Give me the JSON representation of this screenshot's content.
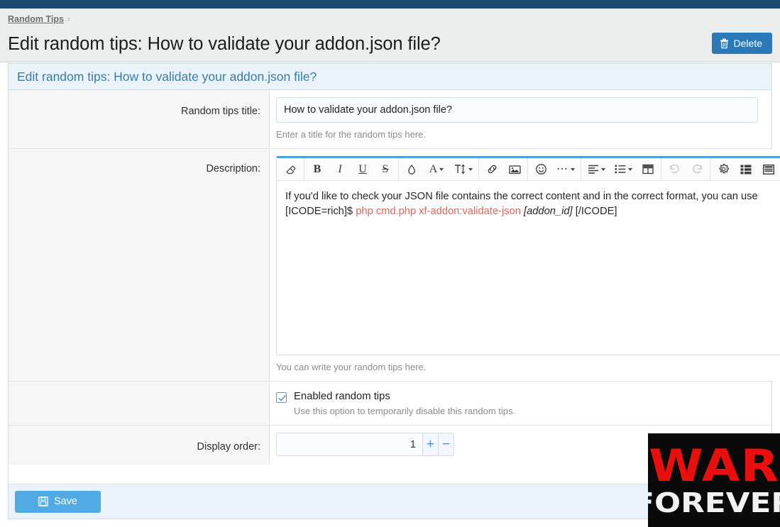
{
  "theme": {
    "topbar_color": "#1c4a70",
    "accent_blue": "#2a7ab9",
    "save_blue": "#52aae4",
    "header_band": "#eaf3fa",
    "code_red": "#e0655b"
  },
  "breadcrumb": {
    "root_label": "Random Tips",
    "separator": "›"
  },
  "header": {
    "page_title": "Edit random tips: How to validate your addon.json file?",
    "delete_label": "Delete",
    "delete_icon": "trash-icon"
  },
  "section": {
    "title": "Edit random tips: How to validate your addon.json file?"
  },
  "form": {
    "title_field": {
      "label": "Random tips title:",
      "value": "How to validate your addon.json file?",
      "placeholder": "",
      "hint": "Enter a title for the random tips here."
    },
    "description_field": {
      "label": "Description:",
      "hint": "You can write your random tips here.",
      "content": {
        "line1": "If you'd like to check your JSON file contains the correct content and in the correct format, you can use",
        "line2_open": "[ICODE=rich]$",
        "line2_code": "php cmd.php xf-addon:validate-json",
        "line2_param": "[addon_id]",
        "line2_close": "[/ICODE]"
      }
    },
    "enabled_field": {
      "label": "Enabled random tips",
      "checked": true,
      "hint": "Use this option to temporarily disable this random tips."
    },
    "display_order_field": {
      "label": "Display order:",
      "value": "1",
      "increment_label": "+",
      "decrement_label": "−"
    }
  },
  "editor_toolbar": {
    "groups": [
      {
        "buttons": [
          {
            "name": "remove-formatting-icon",
            "title": "Remove formatting",
            "glyph": "eraser"
          }
        ]
      },
      {
        "buttons": [
          {
            "name": "bold-icon",
            "title": "Bold",
            "glyph": "B"
          },
          {
            "name": "italic-icon",
            "title": "Italic",
            "glyph": "I"
          },
          {
            "name": "underline-icon",
            "title": "Underline",
            "glyph": "U"
          },
          {
            "name": "strikethrough-icon",
            "title": "Strike through",
            "glyph": "S"
          }
        ]
      },
      {
        "buttons": [
          {
            "name": "text-color-icon",
            "title": "Text color",
            "glyph": "drop"
          },
          {
            "name": "font-family-icon",
            "title": "Font",
            "glyph": "A",
            "has_caret": true
          },
          {
            "name": "font-size-icon",
            "title": "Font size",
            "glyph": "TI",
            "has_caret": true
          }
        ]
      },
      {
        "buttons": [
          {
            "name": "link-icon",
            "title": "Insert link",
            "glyph": "link"
          },
          {
            "name": "image-icon",
            "title": "Insert image",
            "glyph": "image"
          }
        ]
      },
      {
        "buttons": [
          {
            "name": "smilies-icon",
            "title": "Smilies",
            "glyph": "smile"
          },
          {
            "name": "more-options-icon",
            "title": "More options",
            "glyph": "dots",
            "has_caret": true
          }
        ]
      },
      {
        "buttons": [
          {
            "name": "text-align-icon",
            "title": "Alignment",
            "glyph": "align",
            "has_caret": true
          },
          {
            "name": "list-icon",
            "title": "List",
            "glyph": "list",
            "has_caret": true
          },
          {
            "name": "table-icon",
            "title": "Insert table",
            "glyph": "table"
          }
        ]
      },
      {
        "buttons": [
          {
            "name": "undo-icon",
            "title": "Undo",
            "glyph": "undo",
            "disabled": true
          },
          {
            "name": "redo-icon",
            "title": "Redo",
            "glyph": "redo",
            "disabled": true
          }
        ]
      },
      {
        "buttons": [
          {
            "name": "gear-icon",
            "title": "Settings",
            "glyph": "gear"
          },
          {
            "name": "toggle-bb-code-icon",
            "title": "Toggle BB code",
            "glyph": "grid-list"
          },
          {
            "name": "drafts-icon",
            "title": "Drafts",
            "glyph": "grid-box"
          }
        ]
      }
    ]
  },
  "footer": {
    "save_label": "Save",
    "save_icon": "floppy-disk-icon"
  },
  "watermark": {
    "line1": "WAR",
    "line2": "FOREVER"
  }
}
